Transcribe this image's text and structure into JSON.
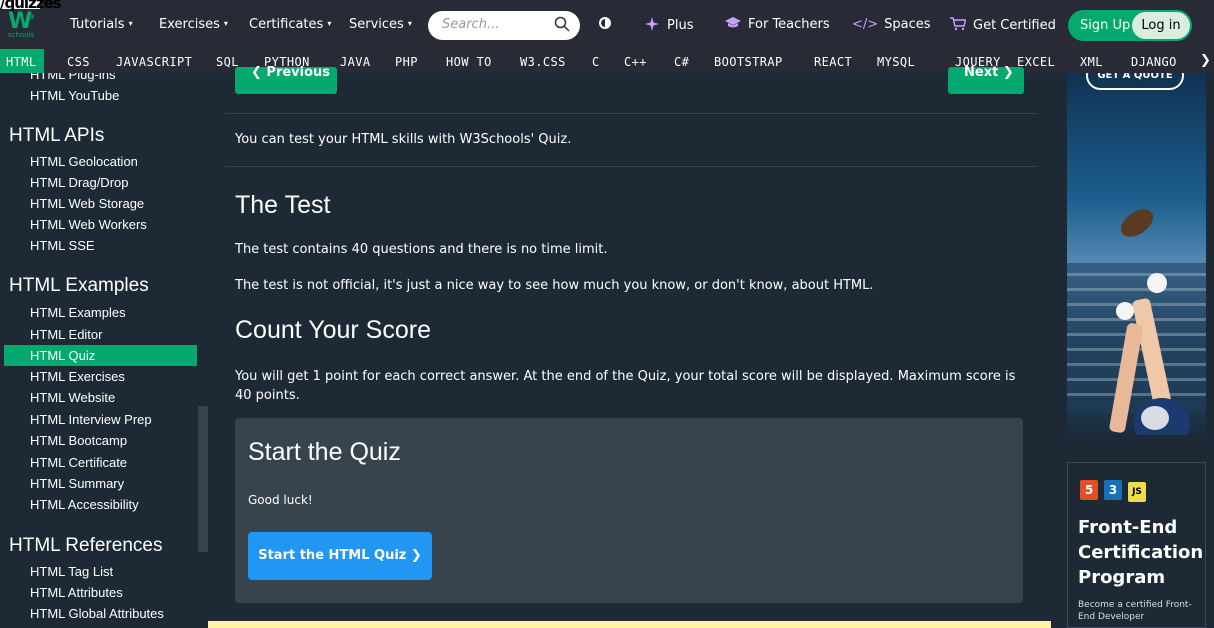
{
  "url_fragment": "/quizzes",
  "header": {
    "logo_text": "W",
    "logo_sup": "3",
    "logo_sub": "schools",
    "nav": [
      {
        "label": "Tutorials",
        "caret": "▾"
      },
      {
        "label": "Exercises",
        "caret": "▾"
      },
      {
        "label": "Certificates",
        "caret": "▾"
      },
      {
        "label": "Services",
        "caret": "▾"
      }
    ],
    "search_placeholder": "Search...",
    "plus": "Plus",
    "teachers": "For Teachers",
    "spaces": "Spaces",
    "get_certified": "Get Certified",
    "signup": "Sign Up",
    "login": "Log in"
  },
  "topics": [
    "HTML",
    "CSS",
    "JAVASCRIPT",
    "SQL",
    "PYTHON",
    "JAVA",
    "PHP",
    "HOW TO",
    "W3.CSS",
    "C",
    "C++",
    "C#",
    "BOOTSTRAP",
    "REACT",
    "MYSQL",
    "JQUERY",
    "EXCEL",
    "XML",
    "DJANGO"
  ],
  "topics_more": "❯",
  "sidebar": {
    "cut_item": "HTML Plug-ins",
    "top_link": "HTML YouTube",
    "apis_head": "HTML APIs",
    "apis": [
      "HTML Geolocation",
      "HTML Drag/Drop",
      "HTML Web Storage",
      "HTML Web Workers",
      "HTML SSE"
    ],
    "examples_head": "HTML Examples",
    "examples": [
      "HTML Examples",
      "HTML Editor",
      "HTML Quiz",
      "HTML Exercises",
      "HTML Website",
      "HTML Interview Prep",
      "HTML Bootcamp",
      "HTML Certificate",
      "HTML Summary",
      "HTML Accessibility"
    ],
    "refs_head": "HTML References",
    "refs": [
      "HTML Tag List",
      "HTML Attributes",
      "HTML Global Attributes"
    ]
  },
  "main": {
    "prev": "❮ Previous",
    "next": "Next ❯",
    "intro": "You can test your HTML skills with W3Schools' Quiz.",
    "test_head": "The Test",
    "test_p1": "The test contains 40 questions and there is no time limit.",
    "test_p2": "The test is not official, it's just a nice way to see how much you know, or don't know, about HTML.",
    "score_head": "Count Your Score",
    "score_p": "You will get 1 point for each correct answer. At the end of the Quiz, your total score will be displayed. Maximum score is 40 points.",
    "quiz_head": "Start the Quiz",
    "good_luck": "Good luck!",
    "start_btn": "Start the HTML Quiz ❯"
  },
  "ads": {
    "get_quote": "GET A QUOTE",
    "badge_html": "5",
    "badge_css": "3",
    "badge_js": "JS",
    "cert_title": "Front-End Certification Program",
    "cert_sub": "Become a certified Front-End Developer"
  },
  "colors": {
    "accent": "#04aa6d",
    "header_bg": "#282a35",
    "page_bg": "#1d2a35",
    "box_bg": "#38444d",
    "button_blue": "#2196f3",
    "highlight": "#fff4a3"
  }
}
